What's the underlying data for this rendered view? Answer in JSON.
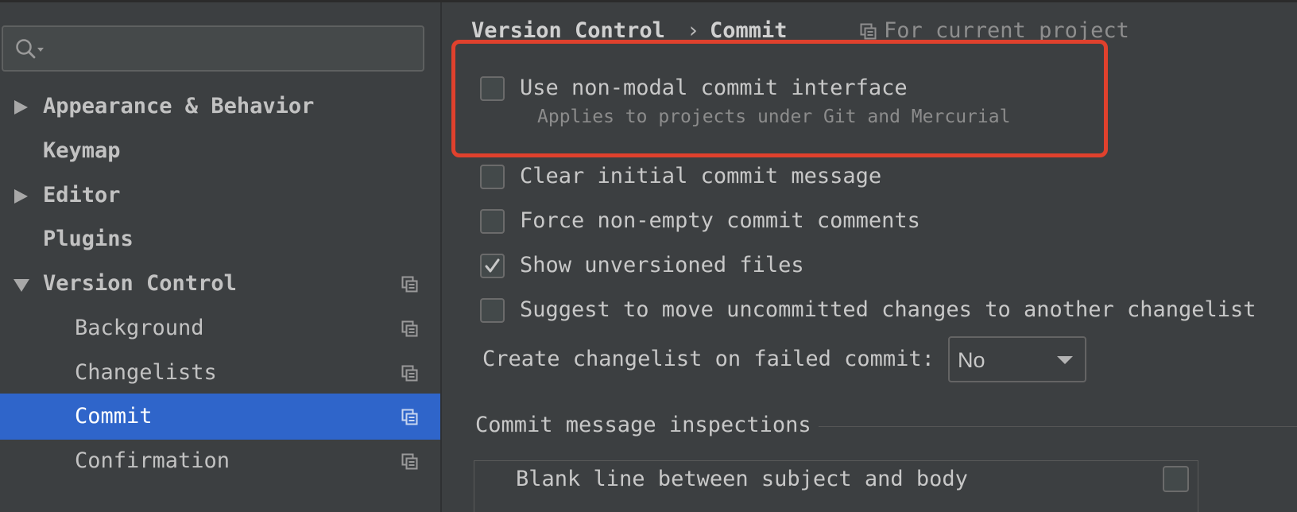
{
  "sidebar": {
    "search": {
      "placeholder": ""
    },
    "items": [
      {
        "label": "Appearance & Behavior"
      },
      {
        "label": "Keymap"
      },
      {
        "label": "Editor"
      },
      {
        "label": "Plugins"
      },
      {
        "label": "Version Control"
      },
      {
        "label": "Background"
      },
      {
        "label": "Changelists"
      },
      {
        "label": "Commit"
      },
      {
        "label": "Confirmation"
      }
    ]
  },
  "header": {
    "crumb_parent": "Version Control",
    "crumb_separator": "›",
    "crumb_current": "Commit",
    "scope": "For current project"
  },
  "options": {
    "non_modal": {
      "label": "Use non-modal commit interface",
      "hint": "Applies to projects under Git and Mercurial",
      "checked": false
    },
    "clear_message": {
      "label": "Clear initial commit message",
      "checked": false
    },
    "force_comments": {
      "label": "Force non-empty commit comments",
      "checked": false
    },
    "show_unversioned": {
      "label": "Show unversioned files",
      "checked": true
    },
    "suggest_move": {
      "label": "Suggest to move uncommitted changes to another changelist",
      "checked": false
    }
  },
  "changelist_on_fail": {
    "label": "Create changelist on failed commit:",
    "value": "No"
  },
  "inspections": {
    "title": "Commit message inspections",
    "rows": [
      {
        "label": "Blank line between subject and body",
        "checked": false
      }
    ]
  },
  "colors": {
    "selection": "#2f65ca",
    "highlight_box": "#e0412d",
    "background": "#3c3f41"
  }
}
